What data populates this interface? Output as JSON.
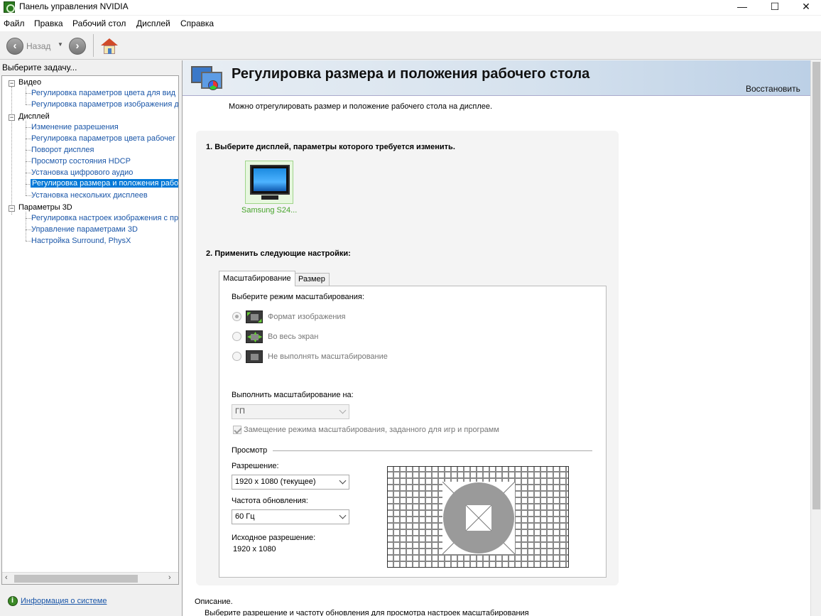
{
  "window": {
    "title": "Панель управления NVIDIA",
    "minimize": "—",
    "maximize": "☐",
    "close": "✕"
  },
  "menu": [
    "Файл",
    "Правка",
    "Рабочий стол",
    "Дисплей",
    "Справка"
  ],
  "toolbar": {
    "back_label": "Назад",
    "back_icon": "arrow-left-icon",
    "forward_icon": "arrow-right-icon",
    "home_icon": "home-icon"
  },
  "left": {
    "header": "Выберите задачу...",
    "categories": [
      {
        "label": "Видео",
        "items": [
          "Регулировка параметров цвета для вид",
          "Регулировка параметров изображения д"
        ]
      },
      {
        "label": "Дисплей",
        "items": [
          "Изменение разрешения",
          "Регулировка параметров цвета рабочег",
          "Поворот дисплея",
          "Просмотр состояния HDCP",
          "Установка цифрового аудио",
          "Регулировка размера и положения рабо",
          "Установка нескольких дисплеев"
        ]
      },
      {
        "label": "Параметры 3D",
        "items": [
          "Регулировка настроек изображения с пр",
          "Управление параметрами 3D",
          "Настройка Surround, PhysX"
        ]
      }
    ],
    "selected_item": "Регулировка размера и положения рабо",
    "system_info": "Информация о системе"
  },
  "main": {
    "title": "Регулировка размера и положения рабочего стола",
    "restore": "Восстановить",
    "intro": "Можно отрегулировать размер и положение рабочего стола на дисплее.",
    "step1": "1. Выберите дисплей, параметры которого требуется изменить.",
    "display_name": "Samsung S24...",
    "step2": "2. Применить следующие настройки:",
    "tabs": [
      "Масштабирование",
      "Размер"
    ],
    "active_tab": "Масштабирование",
    "scaling_mode_label": "Выберите режим масштабирования:",
    "scaling_modes": [
      {
        "label": "Формат изображения",
        "checked": true,
        "icon": "aspect-ratio-icon"
      },
      {
        "label": "Во весь экран",
        "checked": false,
        "icon": "full-screen-icon"
      },
      {
        "label": "Не выполнять масштабирование",
        "checked": false,
        "icon": "no-scaling-icon"
      }
    ],
    "perform_on_label": "Выполнить масштабирование на:",
    "perform_on_value": "ГП",
    "override_label": "Замещение режима масштабирования, заданного для игр и программ",
    "override_checked": true,
    "preview_label": "Просмотр",
    "resolution_label": "Разрешение:",
    "resolution_value": "1920 x 1080 (текущее)",
    "refresh_label": "Частота обновления:",
    "refresh_value": "60 Гц",
    "native_label": "Исходное разрешение:",
    "native_value": "1920 x 1080",
    "description_title": "Описание.",
    "description_text": "Выберите разрешение и частоту обновления для просмотра настроек масштабирования"
  }
}
